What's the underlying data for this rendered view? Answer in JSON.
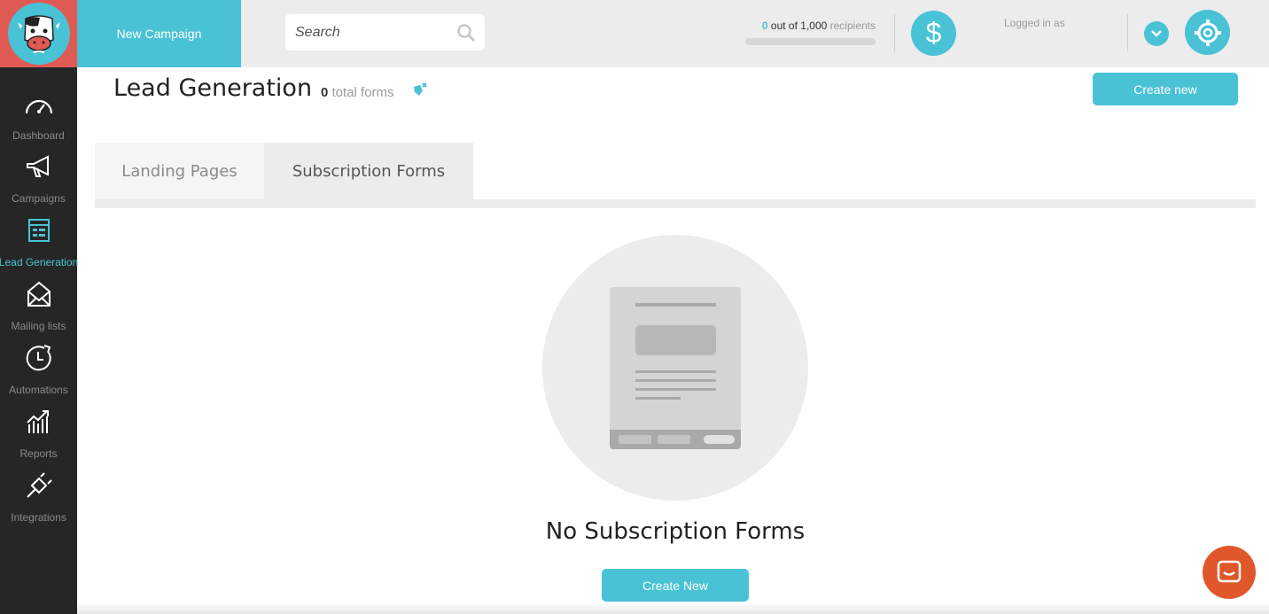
{
  "app": {
    "logo": "cow-mascot-logo"
  },
  "sidebar": {
    "items": [
      {
        "label": "Dashboard",
        "icon": "gauge-icon",
        "active": false
      },
      {
        "label": "Campaigns",
        "icon": "megaphone-icon",
        "active": false
      },
      {
        "label": "Lead Generation",
        "icon": "form-icon",
        "active": true
      },
      {
        "label": "Mailing lists",
        "icon": "envelope-icon",
        "active": false
      },
      {
        "label": "Automations",
        "icon": "clock-icon",
        "active": false
      },
      {
        "label": "Reports",
        "icon": "chart-icon",
        "active": false
      },
      {
        "label": "Integrations",
        "icon": "plug-icon",
        "active": false
      }
    ]
  },
  "topbar": {
    "new_campaign": "New Campaign",
    "search_placeholder": "Search",
    "recipients": {
      "count": "0",
      "of_text": "out of 1,000",
      "suffix": "recipients",
      "progress": 0
    },
    "dollar_symbol": "$",
    "logged_in": "Logged in as"
  },
  "main": {
    "title": "Lead Generation",
    "total_count": "0",
    "total_label": "total forms",
    "create_new": "Create new",
    "tabs": [
      {
        "label": "Landing Pages",
        "active": false
      },
      {
        "label": "Subscription Forms",
        "active": true
      }
    ],
    "empty_title": "No Subscription Forms",
    "empty_button": "Create New"
  },
  "colors": {
    "accent": "#49c2d6",
    "brand_red": "#e05a54",
    "sidebar_bg": "#262626",
    "chat": "#e0572b"
  }
}
